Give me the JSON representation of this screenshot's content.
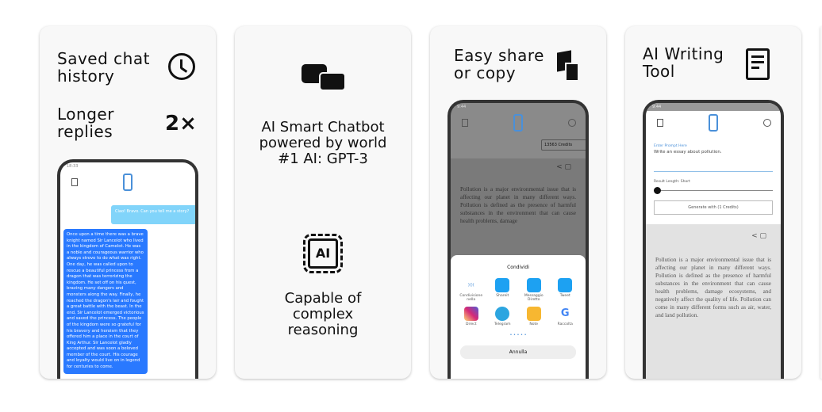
{
  "cards": [
    {
      "line1": "Saved chat",
      "line2": "history",
      "line3": "Longer",
      "line4": "replies",
      "badge": "2×",
      "phone": {
        "status": "18:33",
        "user_msg": "Ciao! Bravo. Can you tell me a story?",
        "bot_msg": "Once upon a time there was a brave knight named Sir Lancelot who lived in the kingdom of Camelot. He was a noble and courageous warrior who always strove to do what was right. One day, he was called upon to rescue a beautiful princess from a dragon that was terrorizing the kingdom. He set off on his quest, braving many dangers and monsters along the way. Finally, he reached the dragon's lair and fought a great battle with the beast. In the end, Sir Lancelot emerged victorious and saved the princess. The people of the kingdom were so grateful for his bravery and heroism that they offered him a place in the court of King Arthur. Sir Lancelot gladly accepted and was soon a beloved member of the court. His courage and loyalty would live on in legend for centuries to come."
      }
    },
    {
      "top": [
        "AI Smart Chatbot",
        "powered by world",
        "#1 AI: GPT-3"
      ],
      "bottom": [
        "Capable of",
        "complex",
        "reasoning"
      ],
      "chip": "AI"
    },
    {
      "line1": "Easy share",
      "line2": "or copy",
      "phone": {
        "status": "9:44",
        "credits": "13563 Credits",
        "text": "Pollution is a major environmental issue that is affecting our planet in many different ways. Pollution is defined as the presence of harmful substances in the environment that can cause health problems, damage",
        "sheet_title": "Condividi",
        "apps": [
          {
            "label": "Condivisione nella",
            "color": "#ffffff"
          },
          {
            "label": "Shareit",
            "color": "#1da1f2"
          },
          {
            "label": "Messaggio Diretto",
            "color": "#1da1f2"
          },
          {
            "label": "Tweet",
            "color": "#1da1f2"
          },
          {
            "label": "Direct",
            "color": "#d6249f"
          },
          {
            "label": "Telegram",
            "color": "#2ca5e0"
          },
          {
            "label": "Note",
            "color": "#f7b731"
          },
          {
            "label": "Raccolta",
            "color": "#ffffff"
          }
        ],
        "cancel": "Annulla"
      }
    },
    {
      "line1": "AI Writing",
      "line2": "Tool",
      "phone": {
        "status": "9:44",
        "prompt_label": "Enter Prompt Here",
        "prompt_value": "Write an essay about pollution.",
        "length_label": "Result Length: Short",
        "slider_value": 0,
        "generate": "Generate with (1 Credits)",
        "text": "Pollution is a major environmental issue that is affecting our planet in many different ways. Pollution is defined as the presence of harmful substances in the environment that can cause health problems, damage ecosystems, and negatively affect the quality of life. Pollution can come in many different forms such as air, water, and land pollution."
      }
    }
  ],
  "colors": {
    "bot_bubble": "#2979ff",
    "user_bubble": "#81d4fa",
    "accent": "#4a90d9"
  }
}
